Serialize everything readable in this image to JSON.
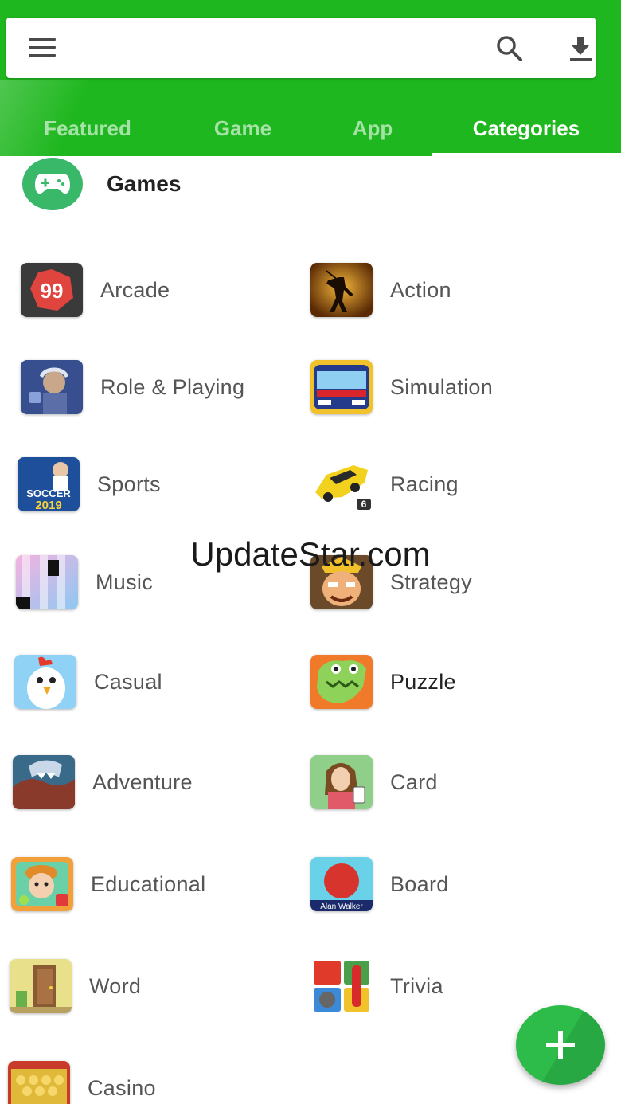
{
  "tabs": [
    "Featured",
    "Game",
    "App",
    "Categories"
  ],
  "active_tab": "Categories",
  "section": {
    "title": "Games",
    "icon": "gamepad-icon"
  },
  "categories": [
    {
      "label": "Arcade",
      "icon": "arcade-icon"
    },
    {
      "label": "Action",
      "icon": "action-icon"
    },
    {
      "label": "Role & Playing",
      "icon": "role-playing-icon"
    },
    {
      "label": "Simulation",
      "icon": "simulation-icon"
    },
    {
      "label": "Sports",
      "icon": "sports-icon"
    },
    {
      "label": "Racing",
      "icon": "racing-icon"
    },
    {
      "label": "Music",
      "icon": "music-icon"
    },
    {
      "label": "Strategy",
      "icon": "strategy-icon"
    },
    {
      "label": "Casual",
      "icon": "casual-icon"
    },
    {
      "label": "Puzzle",
      "icon": "puzzle-icon"
    },
    {
      "label": "Adventure",
      "icon": "adventure-icon"
    },
    {
      "label": "Card",
      "icon": "card-icon"
    },
    {
      "label": "Educational",
      "icon": "educational-icon"
    },
    {
      "label": "Board",
      "icon": "board-icon"
    },
    {
      "label": "Word",
      "icon": "word-icon"
    },
    {
      "label": "Trivia",
      "icon": "trivia-icon"
    },
    {
      "label": "Casino",
      "icon": "casino-icon"
    }
  ],
  "thumb_text": {
    "arcade": "99",
    "sports_line1": "SOCCER",
    "sports_line2": "2019",
    "racing_badge": "6",
    "board_caption": "Alan Walker"
  },
  "watermark": "UpdateStar.com",
  "colors": {
    "header": "#1fb71f",
    "fab": "#2dbb4a",
    "section_icon": "#39b86a"
  }
}
